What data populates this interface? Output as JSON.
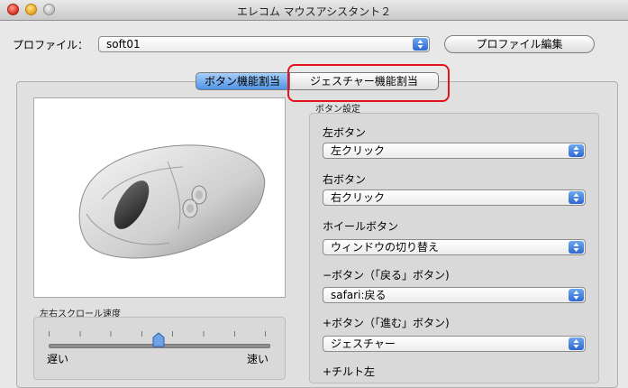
{
  "window": {
    "title": "エレコム マウスアシスタント２"
  },
  "profile": {
    "label": "プロファイル：",
    "value": "soft01",
    "edit_button": "プロファイル編集"
  },
  "tabs": [
    {
      "label": "ボタン機能割当",
      "selected": true
    },
    {
      "label": "ジェスチャー機能割当",
      "selected": false
    }
  ],
  "scroll_speed": {
    "title": "左右スクロール速度",
    "slow_label": "遅い",
    "fast_label": "速い",
    "level": 0.5
  },
  "button_settings": {
    "title": "ボタン設定",
    "items": [
      {
        "label": "左ボタン",
        "value": "左クリック"
      },
      {
        "label": "右ボタン",
        "value": "右クリック"
      },
      {
        "label": "ホイールボタン",
        "value": "ウィンドウの切り替え"
      },
      {
        "label": "−ボタン（「戻る」ボタン)",
        "value": "safari:戻る"
      },
      {
        "label": "+ボタン（「進む」ボタン)",
        "value": "ジェスチャー"
      },
      {
        "label": "+チルト左",
        "value": ""
      }
    ]
  },
  "colors": {
    "accent": "#3b7ddb",
    "highlight_box": "#e3141c"
  }
}
